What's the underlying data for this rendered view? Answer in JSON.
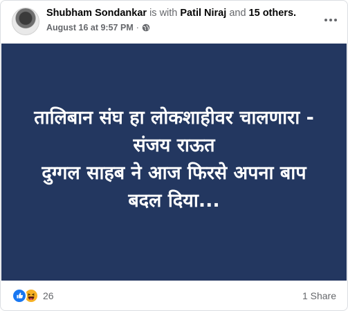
{
  "post": {
    "author": "Shubham Sondankar",
    "with_text": "is with",
    "tagged_person": "Patil Niraj",
    "and_text": "and",
    "others": "15 others.",
    "timestamp": "August 16 at 9:57 PM",
    "separator": "·",
    "privacy_icon": "globe-icon",
    "image_text": {
      "line1": "तालिबान संघ हा लोकशाहीवर चालणारा -",
      "line2": "संजय राऊत",
      "line3": "दुग्गल साहब ने आज फिरसे अपना बाप",
      "line4": "बदल दिया..."
    },
    "image_background": "#233760",
    "reactions": {
      "icons": [
        "like-icon",
        "haha-icon"
      ],
      "count": "26"
    },
    "shares": "1 Share"
  }
}
